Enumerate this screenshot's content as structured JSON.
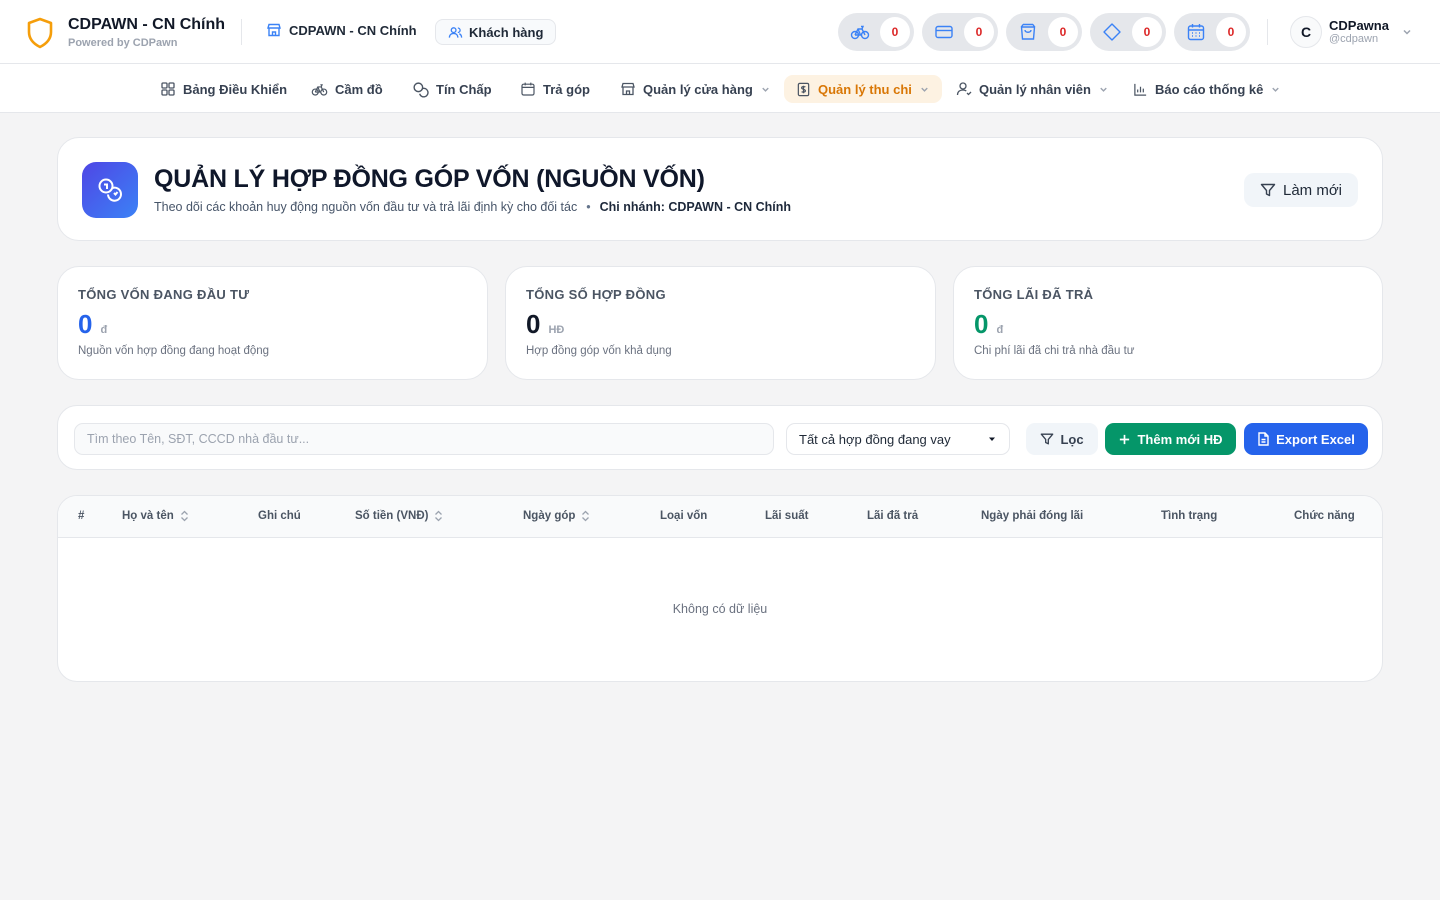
{
  "brand": {
    "title": "CDPAWN - CN Chính",
    "subtitle": "Powered by CDPawn"
  },
  "topbar": {
    "branch_label": "CDPAWN - CN Chính",
    "customer_button": "Khách hàng",
    "counters": [
      {
        "icon": "bicycle-icon",
        "count": "0"
      },
      {
        "icon": "card-icon",
        "count": "0"
      },
      {
        "icon": "bag-icon",
        "count": "0"
      },
      {
        "icon": "diamond-icon",
        "count": "0"
      },
      {
        "icon": "calendar-icon",
        "count": "0"
      }
    ],
    "user": {
      "initial": "C",
      "name": "CDPawna",
      "handle": "@cdpawn"
    }
  },
  "nav": {
    "items": [
      {
        "label": "Bảng Điều Khiển",
        "icon": "dashboard-icon"
      },
      {
        "label": "Cầm đồ",
        "icon": "bicycle-icon"
      },
      {
        "label": "Tín Chấp",
        "icon": "coins-icon"
      },
      {
        "label": "Trả góp",
        "icon": "calendar-icon"
      },
      {
        "label": "Quản lý cửa hàng",
        "icon": "store-icon"
      },
      {
        "label": "Quản lý thu chi",
        "icon": "receipt-icon",
        "active": true
      },
      {
        "label": "Quản lý nhân viên",
        "icon": "user-icon"
      },
      {
        "label": "Báo cáo thống kê",
        "icon": "bar-chart-icon"
      }
    ]
  },
  "header": {
    "title": "QUẢN LÝ HỢP ĐỒNG GÓP VỐN (NGUỒN VỐN)",
    "subtitle": "Theo dõi các khoản huy động nguồn vốn đầu tư và trả lãi định kỳ cho đối tác",
    "separator": "•",
    "branch": "Chi nhánh: CDPAWN - CN Chính",
    "refresh_button": "Làm mới"
  },
  "stats": [
    {
      "label": "TỔNG VỐN ĐANG ĐẦU TƯ",
      "value": "0",
      "unit": "đ",
      "desc": "Nguồn vốn hợp đồng đang hoạt động",
      "color": "#2563eb"
    },
    {
      "label": "TỔNG SỐ HỢP ĐỒNG",
      "value": "0",
      "unit": "HĐ",
      "desc": "Hợp đồng góp vốn khả dụng",
      "color": "#111827"
    },
    {
      "label": "TỔNG LÃI ĐÃ TRẢ",
      "value": "0",
      "unit": "đ",
      "desc": "Chi phí lãi đã chi trả nhà đầu tư",
      "color": "#059669"
    }
  ],
  "filters": {
    "search_placeholder": "Tìm theo Tên, SĐT, CCCD nhà đầu tư...",
    "status_select": "Tất cả hợp đồng đang vay",
    "filter_button": "Lọc",
    "add_button": "Thêm mới HĐ",
    "export_button": "Export Excel"
  },
  "table": {
    "columns": [
      {
        "label": "#",
        "sortable": false
      },
      {
        "label": "Họ và tên",
        "sortable": true
      },
      {
        "label": "Ghi chú",
        "sortable": false
      },
      {
        "label": "Số tiền (VNĐ)",
        "sortable": true
      },
      {
        "label": "Ngày góp",
        "sortable": true
      },
      {
        "label": "Loại vốn",
        "sortable": false
      },
      {
        "label": "Lãi suất",
        "sortable": false
      },
      {
        "label": "Lãi đã trả",
        "sortable": false
      },
      {
        "label": "Ngày phải đóng lãi",
        "sortable": false
      },
      {
        "label": "Tình trạng",
        "sortable": false
      },
      {
        "label": "Chức năng",
        "sortable": false
      }
    ],
    "rows": [],
    "empty_text": "Không có dữ liệu"
  },
  "colors": {
    "accent": "#2563eb",
    "success": "#059669",
    "warning": "#d97706",
    "danger": "#dc2626"
  }
}
